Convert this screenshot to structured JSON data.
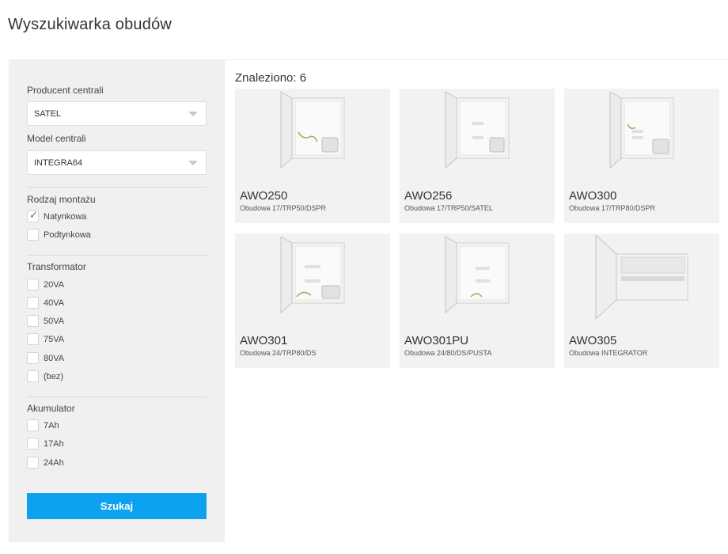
{
  "page": {
    "title": "Wyszukiwarka obudów"
  },
  "filters": {
    "manufacturer": {
      "label": "Producent centrali",
      "value": "SATEL"
    },
    "model": {
      "label": "Model centrali",
      "value": "INTEGRA64"
    },
    "mounting": {
      "label": "Rodzaj montażu",
      "options": [
        {
          "label": "Natynkowa",
          "checked": true
        },
        {
          "label": "Podtynkowa",
          "checked": false
        }
      ]
    },
    "transformer": {
      "label": "Transformator",
      "options": [
        {
          "label": "20VA",
          "checked": false
        },
        {
          "label": "40VA",
          "checked": false
        },
        {
          "label": "50VA",
          "checked": false
        },
        {
          "label": "75VA",
          "checked": false
        },
        {
          "label": "80VA",
          "checked": false
        },
        {
          "label": "(bez)",
          "checked": false
        }
      ]
    },
    "battery": {
      "label": "Akumulator",
      "options": [
        {
          "label": "7Ah",
          "checked": false
        },
        {
          "label": "17Ah",
          "checked": false
        },
        {
          "label": "24Ah",
          "checked": false
        }
      ]
    },
    "search_label": "Szukaj"
  },
  "results": {
    "count_label": "Znaleziono: 6",
    "items": [
      {
        "name": "AWO250",
        "desc": "Obudowa 17/TRP50/DSPR"
      },
      {
        "name": "AWO256",
        "desc": "Obudowa 17/TRP50/SATEL"
      },
      {
        "name": "AWO300",
        "desc": "Obudowa 17/TRP80/DSPR"
      },
      {
        "name": "AWO301",
        "desc": "Obudowa 24/TRP80/DS"
      },
      {
        "name": "AWO301PU",
        "desc": "Obudowa 24/80/DS/PUSTA"
      },
      {
        "name": "AWO305",
        "desc": "Obudowa INTEGRATOR"
      }
    ]
  },
  "colors": {
    "accent": "#0da2f0",
    "sidebar_bg": "#f0f0f0",
    "card_bg": "#f2f2f2"
  }
}
